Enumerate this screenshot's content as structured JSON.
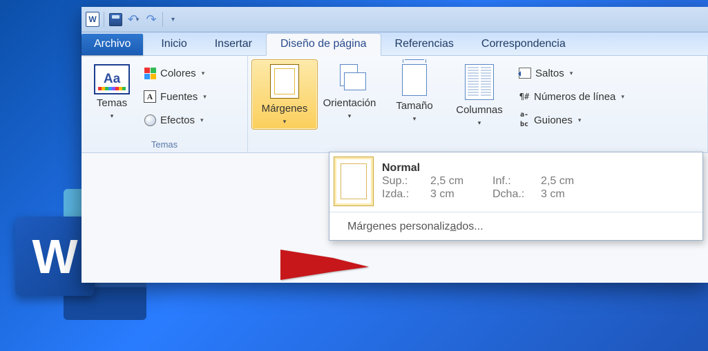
{
  "qat": {
    "word_letter": "W"
  },
  "tabs": {
    "file": "Archivo",
    "items": [
      "Inicio",
      "Insertar",
      "Diseño de página",
      "Referencias",
      "Correspondencia"
    ],
    "activeIndex": 2
  },
  "groups": {
    "temas": {
      "big_label": "Temas",
      "colores": "Colores",
      "fuentes": "Fuentes",
      "efectos": "Efectos",
      "group_label": "Temas"
    },
    "page": {
      "margenes": "Márgenes",
      "orientacion": "Orientación",
      "tamano": "Tamaño",
      "columnas": "Columnas",
      "saltos": "Saltos",
      "numeros": "Números de línea",
      "guiones": "Guiones"
    }
  },
  "dropdown": {
    "preset": {
      "name": "Normal",
      "keys": {
        "top": "Sup.:",
        "bottom": "Inf.:",
        "left": "Izda.:",
        "right": "Dcha.:"
      },
      "values": {
        "top": "2,5 cm",
        "bottom": "2,5 cm",
        "left": "3 cm",
        "right": "3 cm"
      }
    },
    "custom_prefix": "Márgenes personaliz",
    "custom_accel": "a",
    "custom_suffix": "dos..."
  },
  "logo_letter": "W"
}
